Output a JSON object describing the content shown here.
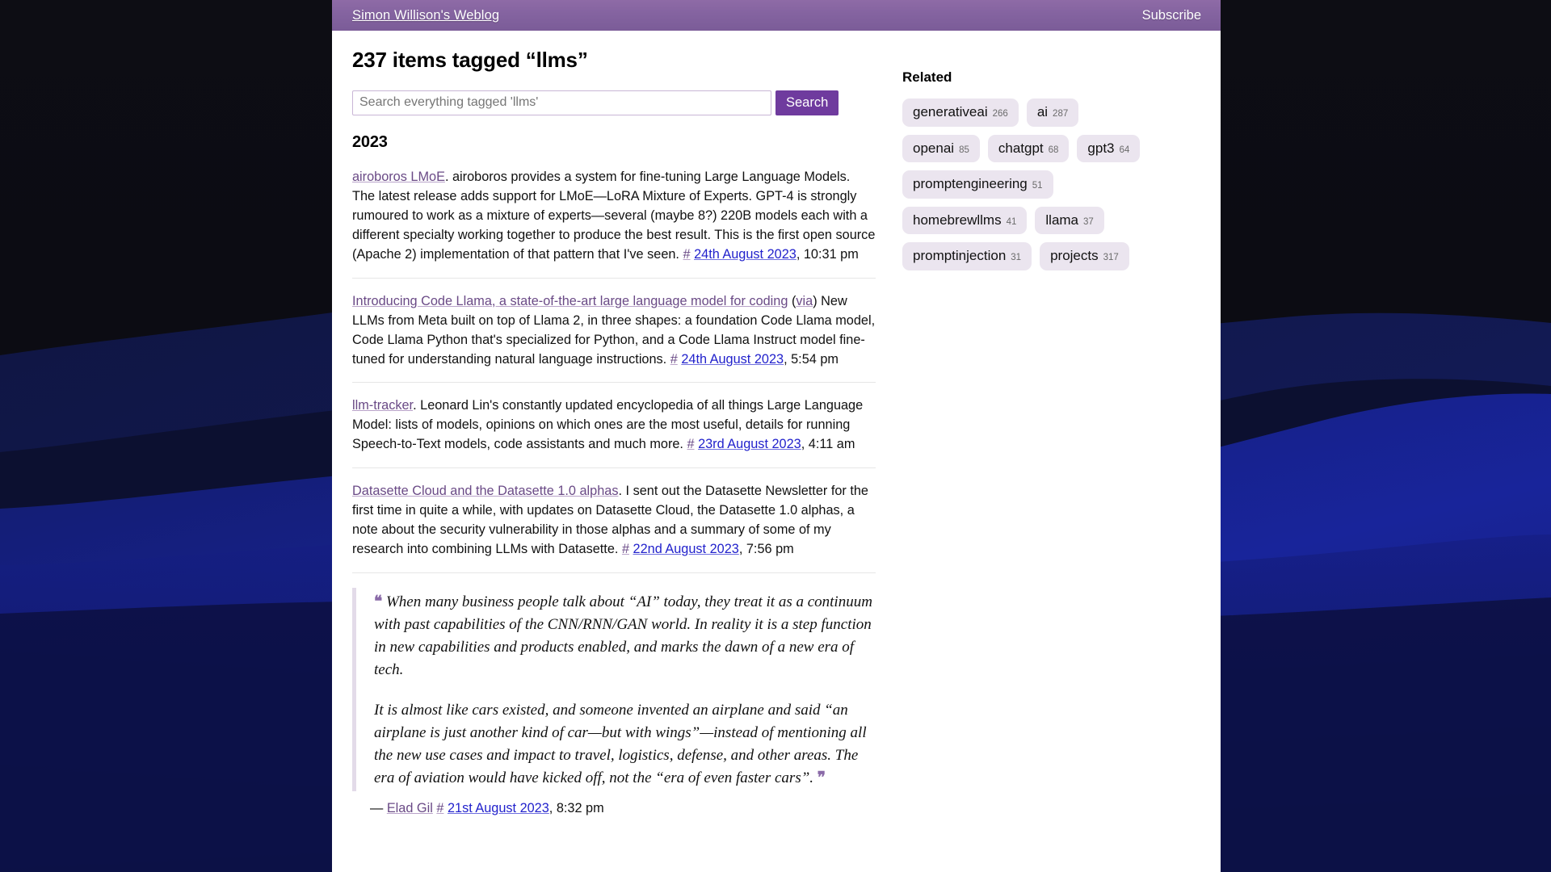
{
  "masthead": {
    "title": "Simon Willison's Weblog",
    "subscribe_label": "Subscribe"
  },
  "main": {
    "page_title": "237 items tagged “llms”",
    "search": {
      "placeholder": "Search everything tagged 'llms'",
      "value": "",
      "button_label": "Search"
    },
    "year_heading": "2023",
    "entries": [
      {
        "title": "airoboros LMoE",
        "title_suffix": ".",
        "body": " airoboros provides a system for fine-tuning Large Language Models. The latest release adds support for LMoE—LoRA Mixture of Experts. GPT-4 is strongly rumoured to work as a mixture of experts—several (maybe 8?) 220B models each with a different specialty working together to produce the best result. This is the first open source (Apache 2) implementation of that pattern that I've seen. ",
        "hash": "#",
        "date": "24th August 2023",
        "time": ", 10:31 pm"
      },
      {
        "title": "Introducing Code Llama, a state-of-the-art large language model for coding",
        "via_open": " (",
        "via": "via",
        "via_close": ")",
        "body": " New LLMs from Meta built on top of Llama 2, in three shapes: a foundation Code Llama model, Code Llama Python that's specialized for Python, and a Code Llama Instruct model fine-tuned for understanding natural language instructions. ",
        "hash": "#",
        "date": "24th August 2023",
        "time": ", 5:54 pm"
      },
      {
        "title": "llm-tracker",
        "title_suffix": ".",
        "body": " Leonard Lin's constantly updated encyclopedia of all things Large Language Model: lists of models, opinions on which ones are the most useful, details for running Speech-to-Text models, code assistants and much more. ",
        "hash": "#",
        "date": "23rd August 2023",
        "time": ", 4:11 am"
      },
      {
        "title": "Datasette Cloud and the Datasette 1.0 alphas",
        "title_suffix": ".",
        "body": " I sent out the Datasette Newsletter for the first time in quite a while, with updates on Datasette Cloud, the Datasette 1.0 alphas, a note about the security vulnerability in those alphas and a summary of some of my research into combining LLMs with Datasette. ",
        "hash": "#",
        "date": "22nd August 2023",
        "time": ", 7:56 pm"
      }
    ],
    "quotation": {
      "open_mark": "❝",
      "close_mark": "❞",
      "paragraph_1": " When many business people talk about “AI” today, they treat it as a continuum with past capabilities of the CNN/RNN/GAN world. In reality it is a step function in new capabilities and products enabled, and marks the dawn of a new era of tech.",
      "paragraph_2": "It is almost like cars existed, and someone invented an airplane and said “an airplane is just another kind of car—but with wings”—instead of mentioning all the new use cases and impact to travel, logistics, defense, and other areas. The era of aviation would have kicked off, not the “era of even faster cars”. ",
      "dash": "— ",
      "author": "Elad Gil",
      "hash": "#",
      "date": "21st August 2023",
      "time": ", 8:32 pm"
    }
  },
  "sidebar": {
    "heading": "Related",
    "tags": [
      {
        "name": "generativeai",
        "count": "266"
      },
      {
        "name": "ai",
        "count": "287"
      },
      {
        "name": "openai",
        "count": "85"
      },
      {
        "name": "chatgpt",
        "count": "68"
      },
      {
        "name": "gpt3",
        "count": "64"
      },
      {
        "name": "promptengineering",
        "count": "51"
      },
      {
        "name": "homebrewllms",
        "count": "41"
      },
      {
        "name": "llama",
        "count": "37"
      },
      {
        "name": "promptinjection",
        "count": "31"
      },
      {
        "name": "projects",
        "count": "317"
      }
    ]
  },
  "colors": {
    "masthead_purple": "#8463a0",
    "search_button": "#6f3b9e",
    "tag_pill_bg": "#ebe5ef",
    "link_purple": "#6a4a86",
    "link_blue": "#2222cc",
    "desktop_dark": "#0b0b12",
    "desktop_blue": "#141b6b",
    "desktop_blue_bright": "#1b2aa8"
  }
}
